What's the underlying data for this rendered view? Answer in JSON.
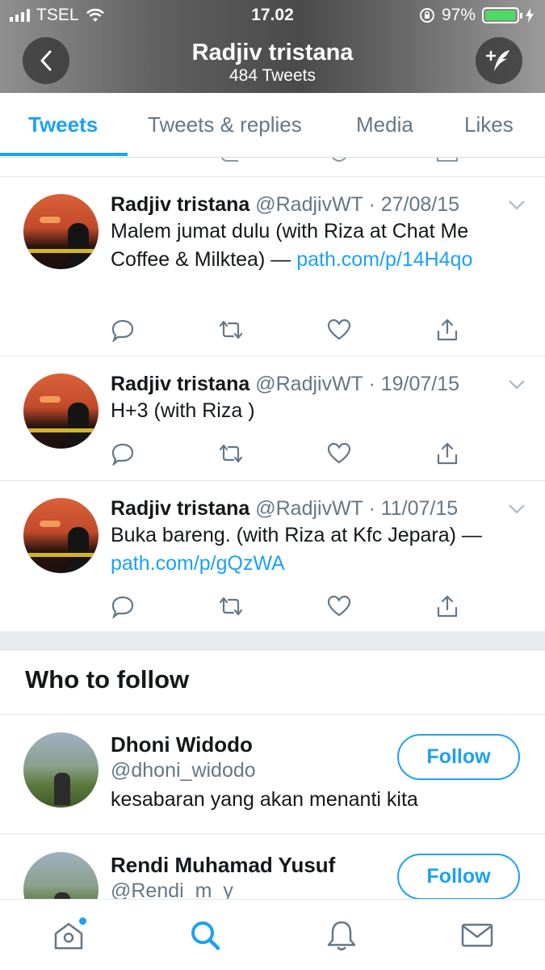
{
  "status_bar": {
    "carrier": "TSEL",
    "time": "17.02",
    "battery": "97%"
  },
  "header": {
    "title": "Radjiv tristana",
    "subtitle": "484 Tweets"
  },
  "tabs": [
    {
      "label": "Tweets",
      "active": true
    },
    {
      "label": "Tweets & replies",
      "active": false
    },
    {
      "label": "Media",
      "active": false
    },
    {
      "label": "Likes",
      "active": false
    }
  ],
  "tweets": [
    {
      "name": "Radjiv tristana",
      "meta": "@RadjivWT · 27/08/15",
      "text_before": "Malem jumat dulu (with Riza  at Chat Me Coffee & Milktea) — ",
      "link": "path.com/p/14H4qo"
    },
    {
      "name": "Radjiv tristana",
      "meta": "@RadjivWT · 19/07/15",
      "text_before": "H+3 (with Riza )",
      "link": ""
    },
    {
      "name": "Radjiv tristana",
      "meta": "@RadjivWT · 11/07/15",
      "text_before": "Buka bareng. (with Riza at Kfc Jepara) — ",
      "link": "path.com/p/gQzWA"
    }
  ],
  "who_to_follow": {
    "title": "Who to follow",
    "button_label": "Follow",
    "items": [
      {
        "name": "Dhoni Widodo",
        "handle": "@dhoni_widodo",
        "bio": "kesabaran yang akan menanti kita"
      },
      {
        "name": "Rendi Muhamad Yusuf",
        "handle": "@Rendi_m_y",
        "bio": ""
      }
    ]
  },
  "icons": {
    "back": "chevron-left-icon",
    "compose": "compose-tweet-icon",
    "reply": "reply-icon",
    "retweet": "retweet-icon",
    "like": "heart-icon",
    "share": "share-icon",
    "nav": [
      "home-icon",
      "search-icon",
      "notifications-icon",
      "messages-icon"
    ]
  },
  "colors": {
    "accent": "#1da1f2",
    "text": "#14171a",
    "muted": "#657786",
    "battery": "#4cd964"
  }
}
